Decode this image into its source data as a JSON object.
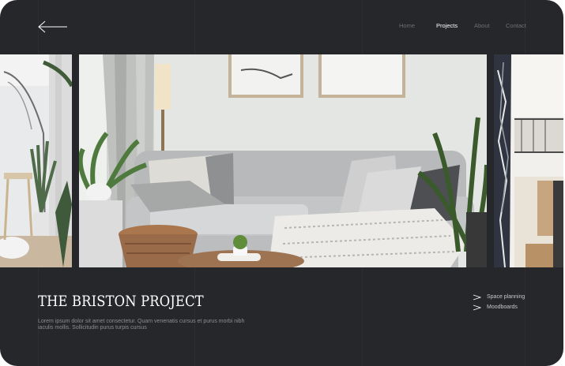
{
  "nav": {
    "items": [
      {
        "label": "Home",
        "active": false
      },
      {
        "label": "Projects",
        "active": true
      },
      {
        "label": "About",
        "active": false
      },
      {
        "label": "Contact",
        "active": false
      }
    ]
  },
  "icons": {
    "back": "arrow-left-icon",
    "service": "chevron-right-icon"
  },
  "project": {
    "title": "THE  BRISTON PROJECT",
    "description": "Lorem ipsum dolor sit amet consectetur. Quam venenatis cursus et purus morbi nibh iaculis mollis. Sollicitudin purus turpis cursus"
  },
  "services": [
    {
      "label": "Space planning"
    },
    {
      "label": "Moodboards"
    }
  ],
  "colors": {
    "background": "#26272a",
    "text": "#ffffff",
    "muted": "#6d6f72",
    "accent_wood": "#9a6b49"
  }
}
